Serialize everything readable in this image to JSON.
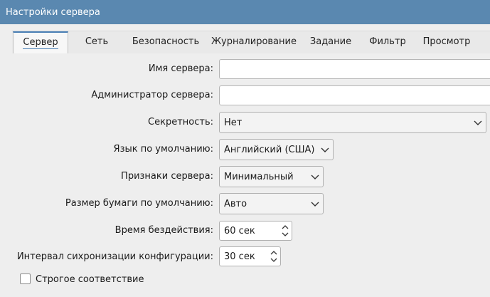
{
  "window": {
    "title": "Настройки сервера"
  },
  "tabs": [
    {
      "label": "Сервер",
      "active": true
    },
    {
      "label": "Сеть"
    },
    {
      "label": "Безопасность"
    },
    {
      "label": "Журналирование"
    },
    {
      "label": "Задание"
    },
    {
      "label": "Фильтр"
    },
    {
      "label": "Просмотр"
    }
  ],
  "form": {
    "server_name": {
      "label": "Имя сервера:",
      "value": ""
    },
    "server_admin": {
      "label": "Администратор сервера:",
      "value": ""
    },
    "classification": {
      "label": "Секретность:",
      "value": "Нет"
    },
    "default_language": {
      "label": "Язык по умолчанию:",
      "value": "Английский (США)"
    },
    "server_tokens": {
      "label": "Признаки сервера:",
      "value": "Минимальный"
    },
    "default_paper_size": {
      "label": "Размер бумаги по умолчанию:",
      "value": "Авто"
    },
    "idle_timeout": {
      "label": "Время бездействия:",
      "value": "60 сек"
    },
    "config_sync_interval": {
      "label": "Интервал сихронизации конфигурации:",
      "value": "30 сек"
    },
    "strict_conformance": {
      "label": "Строгое соответствие",
      "checked": false
    }
  },
  "colors": {
    "titlebar": "#5a88b0",
    "accent": "#4a7fb5",
    "background": "#eeeeee"
  },
  "icons": {
    "combo_arrow": "chevron-down-icon",
    "spinner": "spin-arrows-icon"
  }
}
